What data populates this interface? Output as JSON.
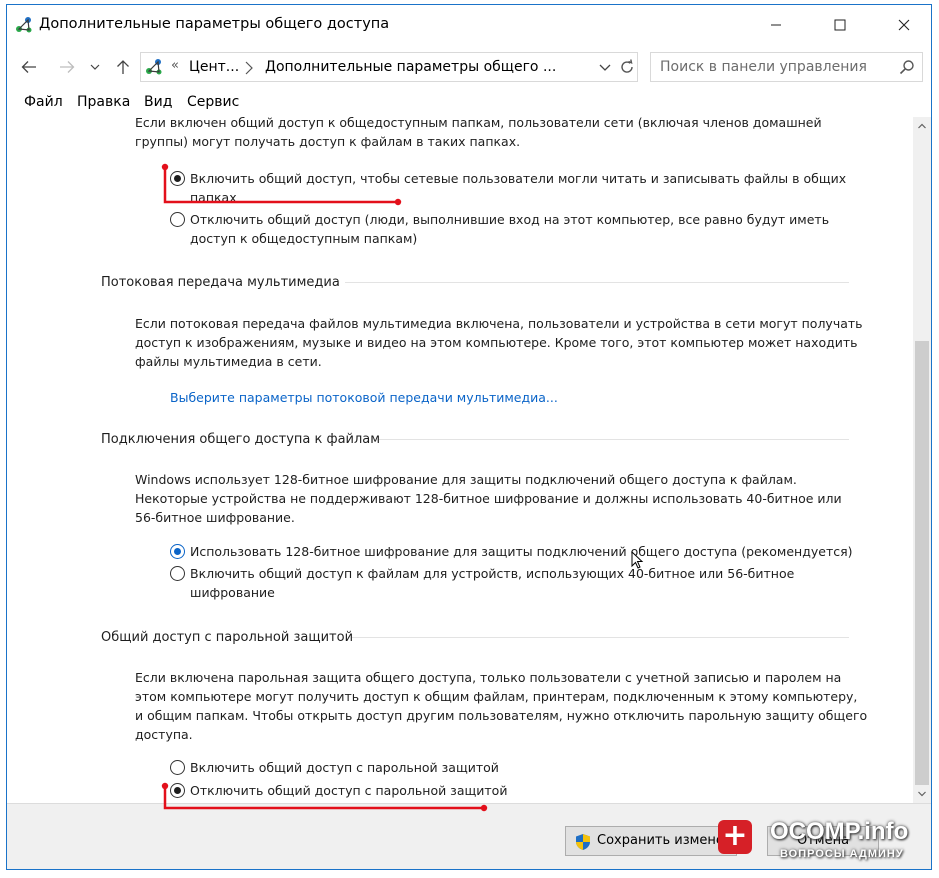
{
  "window": {
    "title": "Дополнительные параметры общего доступа"
  },
  "address": {
    "overflow": "«",
    "crumb1": "Цент...",
    "crumb2": "Дополнительные параметры общего ...",
    "search_placeholder": "Поиск в панели управления"
  },
  "menu": [
    "Файл",
    "Правка",
    "Вид",
    "Сервис"
  ],
  "public_folders": {
    "desc_line1": "Если включен общий доступ к общедоступным папкам, пользователи сети (включая членов домашней",
    "desc_line2": "группы) могут получать доступ к файлам в таких папках.",
    "option_on_line1": "Включить общий доступ, чтобы сетевые пользователи могли читать и записывать файлы в общих",
    "option_on_line2": "папках",
    "option_off_line1": "Отключить общий доступ (люди, выполнившие вход на этот компьютер, все равно будут иметь",
    "option_off_line2": "доступ к общедоступным папкам)",
    "selected": "on"
  },
  "media_streaming": {
    "title": "Потоковая передача мультимедиа",
    "desc_line1": "Если потоковая передача файлов мультимедиа включена, пользователи и устройства в сети могут получать",
    "desc_line2": "доступ к изображениям, музыке и видео на этом компьютере. Кроме того, этот компьютер может находить",
    "desc_line3": "файлы мультимедиа в сети.",
    "link": "Выберите параметры потоковой передачи мультимедиа..."
  },
  "file_sharing": {
    "title": "Подключения общего доступа к файлам",
    "desc_line1": "Windows использует 128-битное шифрование для защиты подключений общего доступа к файлам.",
    "desc_line2": "Некоторые устройства не поддерживают 128-битное шифрование и должны использовать 40-битное или",
    "desc_line3": "56-битное шифрование.",
    "option_128": "Использовать 128-битное шифрование для защиты подключений общего доступа (рекомендуется)",
    "option_40_line1": "Включить общий доступ к файлам для устройств, использующих 40-битное или 56-битное",
    "option_40_line2": "шифрование",
    "selected": "128"
  },
  "password_protected": {
    "title": "Общий доступ с парольной защитой",
    "desc_line1": "Если включена парольная защита общего доступа, только пользователи с учетной записью и паролем на",
    "desc_line2": "этом компьютере могут получить доступ к общим файлам, принтерам, подключенным к этому компьютеру,",
    "desc_line3": "и общим папкам. Чтобы открыть доступ другим пользователям, нужно отключить парольную защиту общего",
    "desc_line4": "доступа.",
    "option_on": "Включить общий доступ с парольной защитой",
    "option_off": "Отключить общий доступ с парольной защитой",
    "selected": "off"
  },
  "footer": {
    "save_label": "Сохранить изменения",
    "cancel_label": "Отмена"
  },
  "watermark": {
    "brand": "OCOMP.info",
    "tagline": "ВОПРОСЫ АДМИНУ"
  },
  "colors": {
    "accent": "#0a64c8",
    "annotation": "#e3101b",
    "window_border": "#1a73c9"
  }
}
